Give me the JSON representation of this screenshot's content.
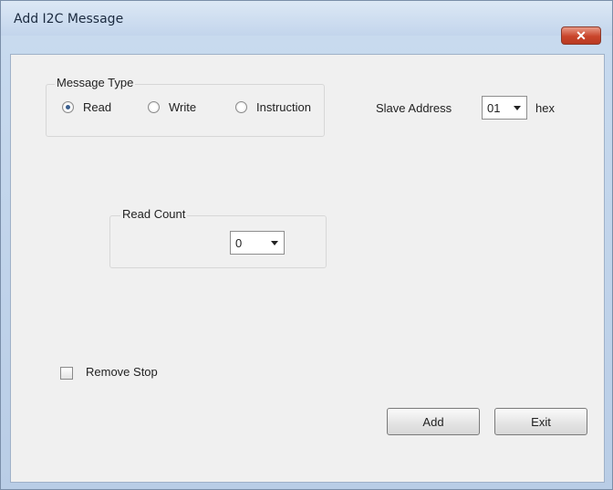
{
  "window": {
    "title": "Add I2C Message",
    "close_label": "✕"
  },
  "message_type": {
    "label": "Message Type",
    "options": [
      {
        "label": "Read",
        "checked": true
      },
      {
        "label": "Write",
        "checked": false
      },
      {
        "label": "Instruction",
        "checked": false
      }
    ]
  },
  "slave_address": {
    "label": "Slave Address",
    "value": "01",
    "unit": "hex"
  },
  "read_count": {
    "label": "Read Count",
    "value": "0"
  },
  "remove_stop": {
    "label": "Remove Stop",
    "checked": false
  },
  "buttons": {
    "add": "Add",
    "exit": "Exit"
  }
}
